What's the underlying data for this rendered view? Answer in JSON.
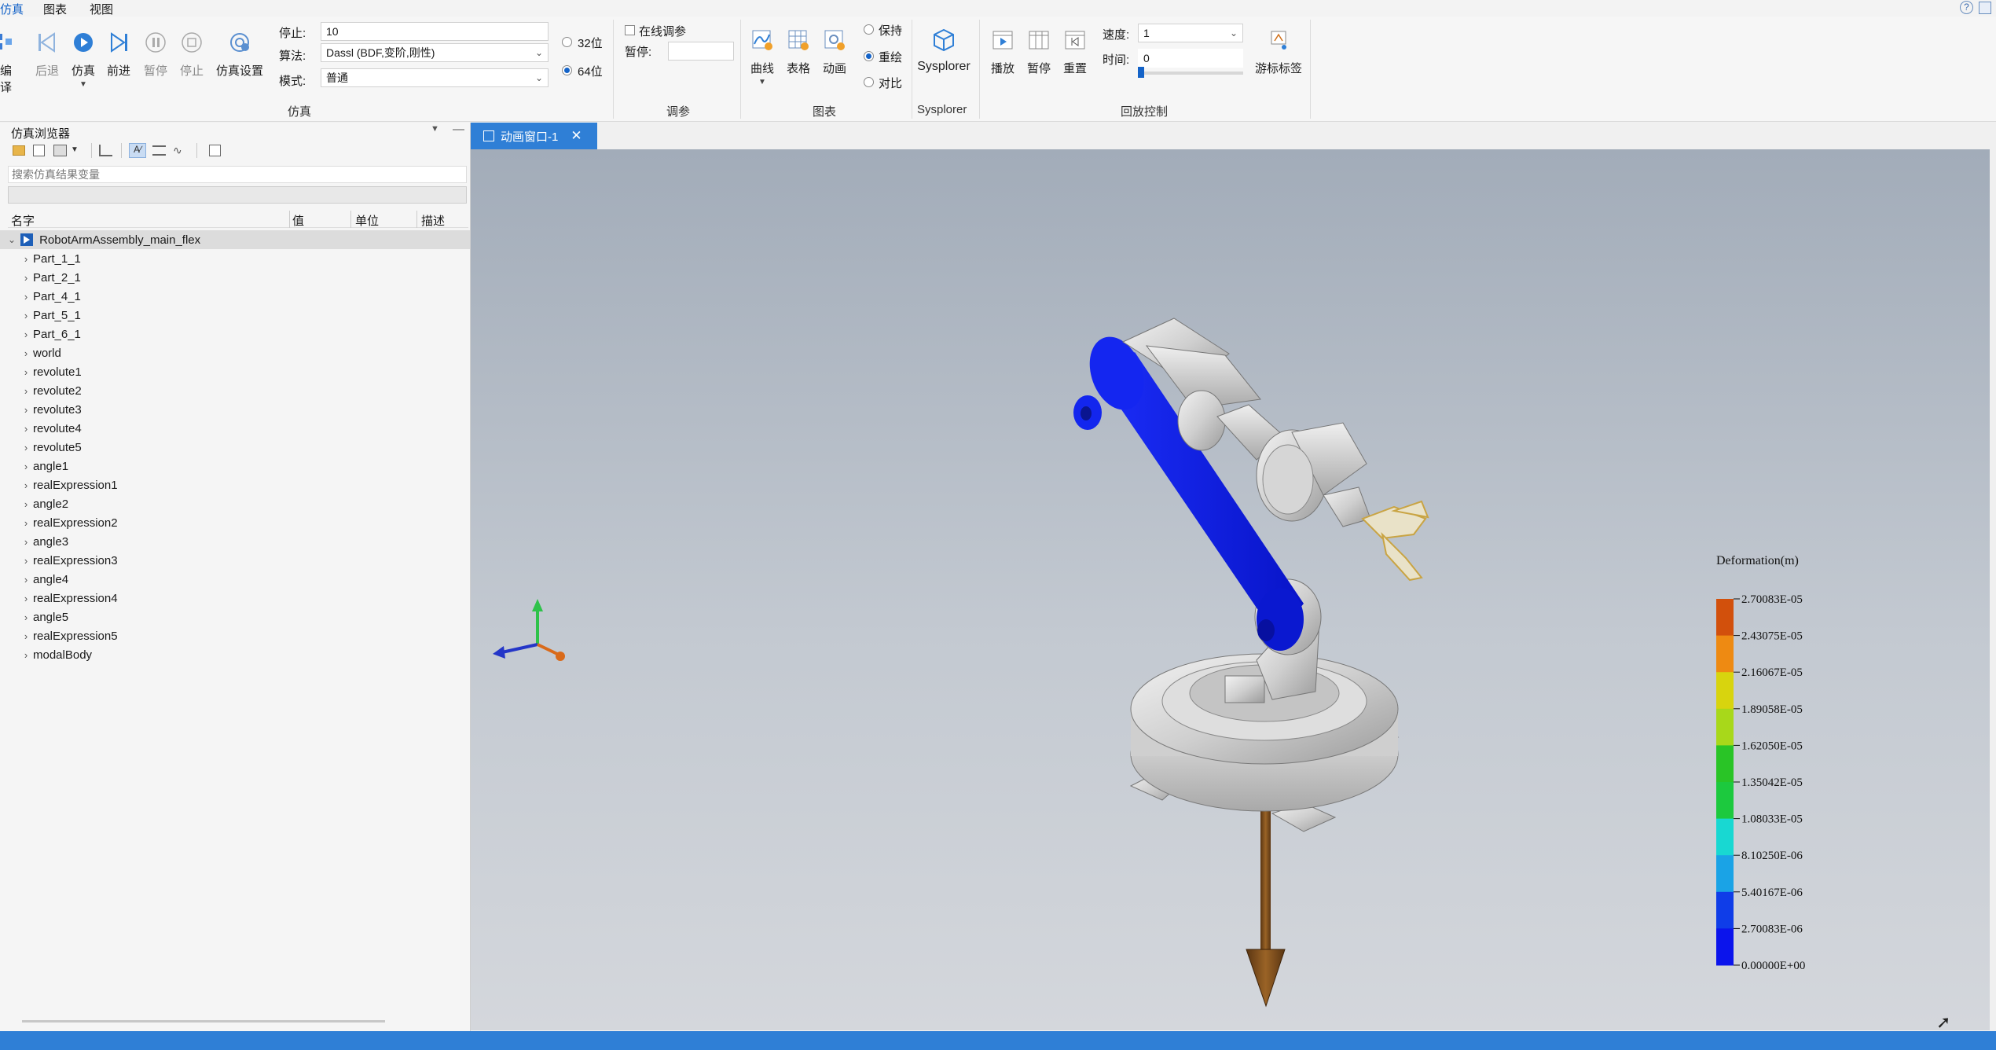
{
  "menu": {
    "items": [
      "仿真",
      "图表",
      "视图"
    ]
  },
  "ribbon": {
    "sim": {
      "compile": "编译",
      "back": "后退",
      "simulate": "仿真",
      "forward": "前进",
      "pause": "暂停",
      "stop": "停止",
      "settings": "仿真设置",
      "stop_time_label": "停止:",
      "stop_time_value": "10",
      "algorithm_label": "算法:",
      "algorithm_value": "Dassl (BDF,变阶,刚性)",
      "mode_label": "模式:",
      "mode_value": "普通",
      "bit32": "32位",
      "bit64": "64位",
      "group": "仿真"
    },
    "tuning": {
      "online": "在线调参",
      "pause_label": "暂停:",
      "group": "调参"
    },
    "charts": {
      "curve": "曲线",
      "table": "表格",
      "animation": "动画",
      "keep": "保持",
      "overlay": "重绘",
      "compare": "对比",
      "group": "图表"
    },
    "sysplorer": {
      "label": "Sysplorer",
      "group": "Sysplorer"
    },
    "playback": {
      "play": "播放",
      "pause": "暂停",
      "reset": "重置",
      "speed_label": "速度:",
      "speed_value": "1",
      "time_label": "时间:",
      "time_value": "0",
      "cursor_tag": "游标标签",
      "group": "回放控制"
    }
  },
  "browser": {
    "title": "仿真浏览器",
    "search_placeholder": "搜索仿真结果变量",
    "columns": [
      "名字",
      "值",
      "单位",
      "描述"
    ],
    "root": "RobotArmAssembly_main_flex",
    "items": [
      "Part_1_1",
      "Part_2_1",
      "Part_4_1",
      "Part_5_1",
      "Part_6_1",
      "world",
      "revolute1",
      "revolute2",
      "revolute3",
      "revolute4",
      "revolute5",
      "angle1",
      "realExpression1",
      "angle2",
      "realExpression2",
      "angle3",
      "realExpression3",
      "angle4",
      "realExpression4",
      "angle5",
      "realExpression5",
      "modalBody"
    ]
  },
  "tab": {
    "title": "动画窗口-1"
  },
  "legend": {
    "title": "Deformation(m)",
    "labels": [
      "2.70083E-05",
      "2.43075E-05",
      "2.16067E-05",
      "1.89058E-05",
      "1.62050E-05",
      "1.35042E-05",
      "1.08033E-05",
      "8.10250E-06",
      "5.40167E-06",
      "2.70083E-06",
      "0.00000E+00"
    ],
    "colors": [
      "#d2500c",
      "#ee8a12",
      "#d8d40e",
      "#a8d81a",
      "#29c426",
      "#1cc93e",
      "#18d8d2",
      "#1aa3e6",
      "#0f3de8",
      "#0b14ec"
    ]
  },
  "colors": {
    "accent": "#2f7fd6",
    "highlight_blue": "#0a1ff0"
  }
}
